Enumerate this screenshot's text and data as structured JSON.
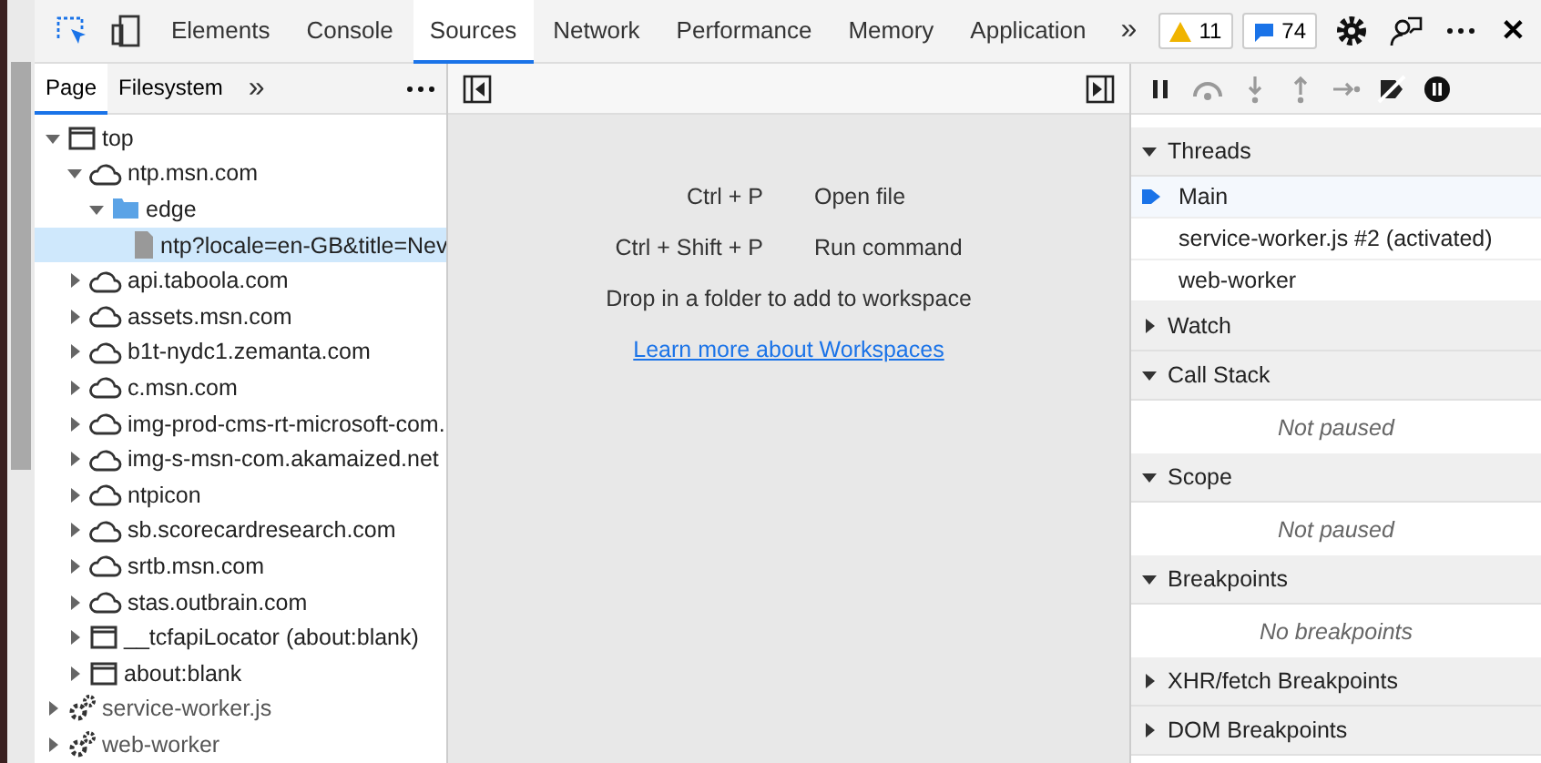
{
  "main_tabs": [
    {
      "label": "Elements",
      "selected": false
    },
    {
      "label": "Console",
      "selected": false
    },
    {
      "label": "Sources",
      "selected": true
    },
    {
      "label": "Network",
      "selected": false
    },
    {
      "label": "Performance",
      "selected": false
    },
    {
      "label": "Memory",
      "selected": false
    },
    {
      "label": "Application",
      "selected": false
    }
  ],
  "more_tabs": "»",
  "warnings": "11",
  "messages": "74",
  "close": "✕",
  "navigator_tabs": [
    {
      "label": "Page",
      "selected": true
    },
    {
      "label": "Filesystem",
      "selected": false
    }
  ],
  "navigator_more": "»",
  "tree": [
    {
      "kind": "frame",
      "label": "top",
      "expanded": true,
      "selected": false,
      "children": [
        {
          "kind": "domain",
          "label": "ntp.msn.com",
          "expanded": true,
          "selected": false,
          "children": [
            {
              "kind": "folder",
              "label": "edge",
              "expanded": true,
              "selected": false,
              "children": [
                {
                  "kind": "file",
                  "label": "ntp?locale=en-GB&title=Nev",
                  "selected": true
                }
              ]
            }
          ]
        },
        {
          "kind": "domain",
          "label": "api.taboola.com",
          "expanded": false,
          "selected": false
        },
        {
          "kind": "domain",
          "label": "assets.msn.com",
          "expanded": false,
          "selected": false
        },
        {
          "kind": "domain",
          "label": "b1t-nydc1.zemanta.com",
          "expanded": false,
          "selected": false
        },
        {
          "kind": "domain",
          "label": "c.msn.com",
          "expanded": false,
          "selected": false
        },
        {
          "kind": "domain",
          "label": "img-prod-cms-rt-microsoft-com.",
          "expanded": false,
          "selected": false
        },
        {
          "kind": "domain",
          "label": "img-s-msn-com.akamaized.net",
          "expanded": false,
          "selected": false
        },
        {
          "kind": "domain",
          "label": "ntpicon",
          "expanded": false,
          "selected": false
        },
        {
          "kind": "domain",
          "label": "sb.scorecardresearch.com",
          "expanded": false,
          "selected": false
        },
        {
          "kind": "domain",
          "label": "srtb.msn.com",
          "expanded": false,
          "selected": false
        },
        {
          "kind": "domain",
          "label": "stas.outbrain.com",
          "expanded": false,
          "selected": false
        },
        {
          "kind": "frame",
          "label": "__tcfapiLocator (about:blank)",
          "expanded": false,
          "selected": false
        },
        {
          "kind": "frame",
          "label": "about:blank",
          "expanded": false,
          "selected": false
        }
      ]
    },
    {
      "kind": "worker",
      "label": "service-worker.js",
      "expanded": false,
      "selected": false
    },
    {
      "kind": "worker",
      "label": "web-worker",
      "expanded": false,
      "selected": false
    }
  ],
  "shortcuts": [
    {
      "keys": "Ctrl + P",
      "action": "Open file"
    },
    {
      "keys": "Ctrl + Shift + P",
      "action": "Run command"
    }
  ],
  "drop_hint": "Drop in a folder to add to workspace",
  "learn_link": "Learn more about Workspaces",
  "sections": [
    {
      "title": "Threads",
      "expanded": true,
      "threads": [
        {
          "label": "Main",
          "selected": true
        },
        {
          "label": "service-worker.js #2 (activated)",
          "selected": false
        },
        {
          "label": "web-worker",
          "selected": false
        }
      ]
    },
    {
      "title": "Watch",
      "expanded": false
    },
    {
      "title": "Call Stack",
      "expanded": true,
      "message": "Not paused"
    },
    {
      "title": "Scope",
      "expanded": true,
      "message": "Not paused"
    },
    {
      "title": "Breakpoints",
      "expanded": true,
      "message": "No breakpoints"
    },
    {
      "title": "XHR/fetch Breakpoints",
      "expanded": false
    },
    {
      "title": "DOM Breakpoints",
      "expanded": false
    }
  ]
}
